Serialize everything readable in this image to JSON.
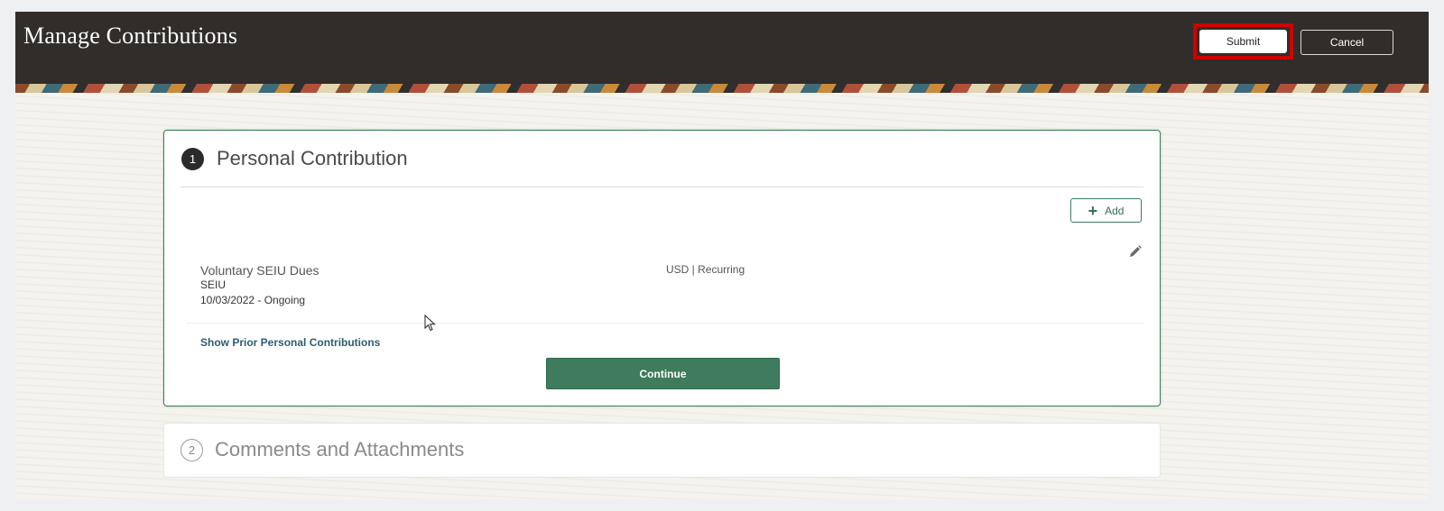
{
  "header": {
    "title": "Manage Contributions",
    "submit_label": "Submit",
    "cancel_label": "Cancel"
  },
  "steps": [
    {
      "number": "1",
      "title": "Personal Contribution",
      "add_label": "Add",
      "contribution": {
        "name": "Voluntary SEIU Dues",
        "organization": "SEIU",
        "dates": "10/03/2022 - Ongoing",
        "type": "USD | Recurring"
      },
      "prior_link": "Show Prior Personal Contributions",
      "continue_label": "Continue"
    },
    {
      "number": "2",
      "title": "Comments and Attachments"
    }
  ],
  "icons": {
    "add": "plus-icon",
    "edit": "pencil-icon",
    "cursor": "mouse-pointer-icon"
  },
  "colors": {
    "header_bg": "#312d2a",
    "accent_green": "#3f7c5d",
    "link_blue": "#2d5e73",
    "highlight_red": "#d00000"
  }
}
